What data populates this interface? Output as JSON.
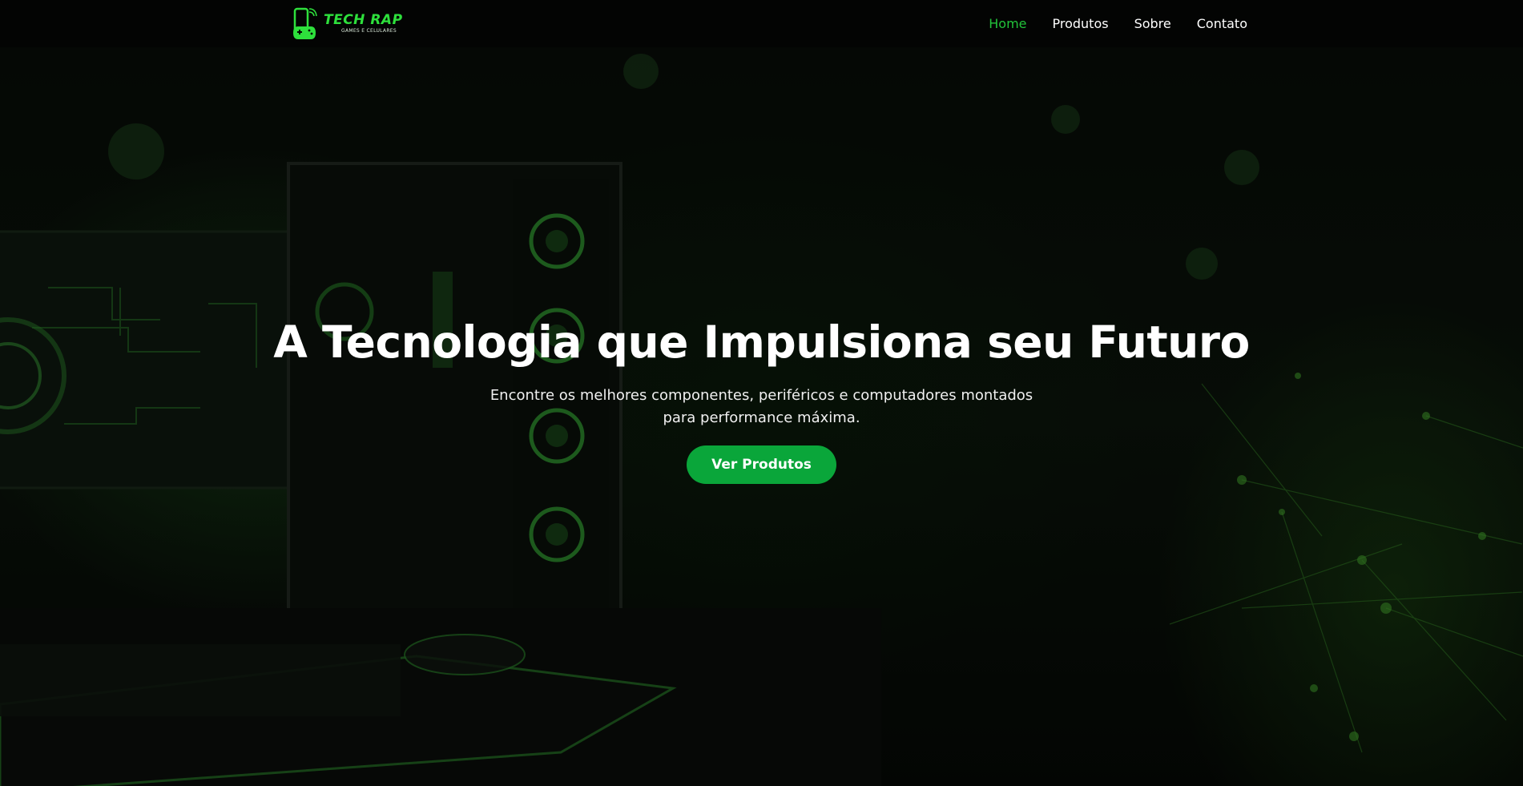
{
  "brand": {
    "name": "TECH RAP",
    "tagline": "GAMES E CELULARES",
    "accent": "#22c33a",
    "cta_color": "#0aa63a"
  },
  "nav": {
    "items": [
      {
        "label": "Home",
        "active": true
      },
      {
        "label": "Produtos",
        "active": false
      },
      {
        "label": "Sobre",
        "active": false
      },
      {
        "label": "Contato",
        "active": false
      }
    ]
  },
  "hero": {
    "title": "A Tecnologia que Impulsiona seu Futuro",
    "subtitle": "Encontre os melhores componentes, periféricos e computadores montados para performance máxima.",
    "cta_label": "Ver Produtos"
  }
}
